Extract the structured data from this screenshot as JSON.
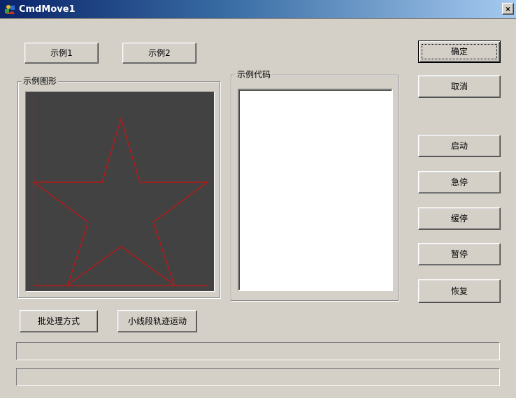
{
  "window": {
    "title": "CmdMove1",
    "close_glyph": "×"
  },
  "buttons": {
    "example1": "示例1",
    "example2": "示例2",
    "ok": "确定",
    "cancel": "取消",
    "start": "启动",
    "emergency_stop": "急停",
    "slow_stop": "缓停",
    "pause": "暂停",
    "resume": "恢复",
    "batch_mode": "批处理方式",
    "small_segment_motion": "小线段轨迹运动"
  },
  "groups": {
    "example_figure": "示例图形",
    "example_code": "示例代码"
  },
  "code_text": "",
  "status": {
    "line1": "",
    "line2": ""
  },
  "colors": {
    "face": "#d4d0c8",
    "canvas_bg": "#424242",
    "star_line": "#cc1111"
  },
  "icons": {
    "app": "app-icon",
    "close": "close-icon"
  }
}
